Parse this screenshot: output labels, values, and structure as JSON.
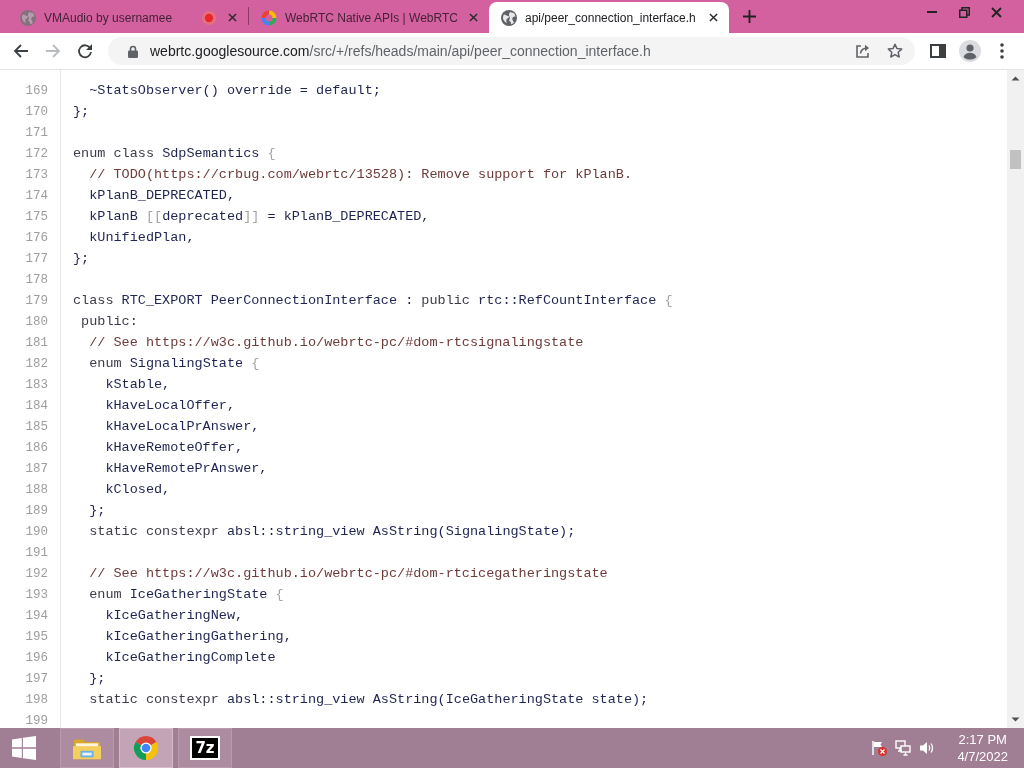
{
  "tabs": [
    {
      "title": "VMAudio by usernamee",
      "recording": true,
      "selected": false
    },
    {
      "title": "WebRTC Native APIs | WebRTC",
      "recording": false,
      "selected": false
    },
    {
      "title": "api/peer_connection_interface.h",
      "recording": false,
      "selected": true
    }
  ],
  "toolbar": {
    "back_disabled": false,
    "forward_disabled": true,
    "url_host": "webrtc.googlesource.com",
    "url_path": "/src/+/refs/heads/main/api/peer_connection_interface.h"
  },
  "code": {
    "lines": [
      {
        "number": "169",
        "segments": [
          {
            "text": "  ~StatsObserver() override = default;",
            "kind": "plain"
          }
        ]
      },
      {
        "number": "170",
        "segments": [
          {
            "text": "};",
            "kind": "plain"
          }
        ]
      },
      {
        "number": "171"
      },
      {
        "number": "172",
        "segments": [
          {
            "text": "enum class ",
            "kind": "keyword"
          },
          {
            "text": "SdpSemantics ",
            "kind": "plain"
          },
          {
            "text": "{",
            "kind": "punct"
          }
        ]
      },
      {
        "number": "173",
        "segments": [
          {
            "text": "  // TODO(https://crbug.com/webrtc/13528): Remove support for kPlanB.",
            "kind": "comment"
          }
        ]
      },
      {
        "number": "174",
        "segments": [
          {
            "text": "  kPlanB_DEPRECATED,",
            "kind": "plain"
          }
        ]
      },
      {
        "number": "175",
        "segments": [
          {
            "text": "  kPlanB ",
            "kind": "plain"
          },
          {
            "text": "[[",
            "kind": "punct"
          },
          {
            "text": "deprecated",
            "kind": "plain"
          },
          {
            "text": "]]",
            "kind": "punct"
          },
          {
            "text": " = kPlanB_DEPRECATED,",
            "kind": "plain"
          }
        ]
      },
      {
        "number": "176",
        "segments": [
          {
            "text": "  kUnifiedPlan,",
            "kind": "plain"
          }
        ]
      },
      {
        "number": "177",
        "segments": [
          {
            "text": "};",
            "kind": "plain"
          }
        ]
      },
      {
        "number": "178"
      },
      {
        "number": "179",
        "segments": [
          {
            "text": "class ",
            "kind": "keyword"
          },
          {
            "text": "RTC_EXPORT PeerConnectionInterface : ",
            "kind": "plain"
          },
          {
            "text": "public ",
            "kind": "keyword"
          },
          {
            "text": "rtc::RefCountInterface ",
            "kind": "plain"
          },
          {
            "text": "{",
            "kind": "punct"
          }
        ]
      },
      {
        "number": "180",
        "segments": [
          {
            "text": " public:",
            "kind": "keyword"
          }
        ]
      },
      {
        "number": "181",
        "segments": [
          {
            "text": "  // See https://w3c.github.io/webrtc-pc/#dom-rtcsignalingstate",
            "kind": "comment"
          }
        ]
      },
      {
        "number": "182",
        "segments": [
          {
            "text": "  enum ",
            "kind": "keyword"
          },
          {
            "text": "SignalingState ",
            "kind": "plain"
          },
          {
            "text": "{",
            "kind": "punct"
          }
        ]
      },
      {
        "number": "183",
        "segments": [
          {
            "text": "    kStable,",
            "kind": "plain"
          }
        ]
      },
      {
        "number": "184",
        "segments": [
          {
            "text": "    kHaveLocalOffer,",
            "kind": "plain"
          }
        ]
      },
      {
        "number": "185",
        "segments": [
          {
            "text": "    kHaveLocalPrAnswer,",
            "kind": "plain"
          }
        ]
      },
      {
        "number": "186",
        "segments": [
          {
            "text": "    kHaveRemoteOffer,",
            "kind": "plain"
          }
        ]
      },
      {
        "number": "187",
        "segments": [
          {
            "text": "    kHaveRemotePrAnswer,",
            "kind": "plain"
          }
        ]
      },
      {
        "number": "188",
        "segments": [
          {
            "text": "    kClosed,",
            "kind": "plain"
          }
        ]
      },
      {
        "number": "189",
        "segments": [
          {
            "text": "  };",
            "kind": "plain"
          }
        ]
      },
      {
        "number": "190",
        "segments": [
          {
            "text": "  static constexpr ",
            "kind": "keyword"
          },
          {
            "text": "absl::string_view AsString(SignalingState);",
            "kind": "plain"
          }
        ]
      },
      {
        "number": "191"
      },
      {
        "number": "192",
        "segments": [
          {
            "text": "  // See https://w3c.github.io/webrtc-pc/#dom-rtcicegatheringstate",
            "kind": "comment"
          }
        ]
      },
      {
        "number": "193",
        "segments": [
          {
            "text": "  enum ",
            "kind": "keyword"
          },
          {
            "text": "IceGatheringState ",
            "kind": "plain"
          },
          {
            "text": "{",
            "kind": "punct"
          }
        ]
      },
      {
        "number": "194",
        "segments": [
          {
            "text": "    kIceGatheringNew,",
            "kind": "plain"
          }
        ]
      },
      {
        "number": "195",
        "segments": [
          {
            "text": "    kIceGatheringGathering,",
            "kind": "plain"
          }
        ]
      },
      {
        "number": "196",
        "segments": [
          {
            "text": "    kIceGatheringComplete",
            "kind": "plain"
          }
        ]
      },
      {
        "number": "197",
        "segments": [
          {
            "text": "  };",
            "kind": "plain"
          }
        ]
      },
      {
        "number": "198",
        "segments": [
          {
            "text": "  static constexpr ",
            "kind": "keyword"
          },
          {
            "text": "absl::string_view AsString(IceGatheringState state);",
            "kind": "plain"
          }
        ]
      },
      {
        "number": "199"
      }
    ]
  },
  "taskbar": {
    "apps": [
      {
        "kind": "explorer",
        "selected": false
      },
      {
        "kind": "browser",
        "selected": true
      },
      {
        "kind": "archiver",
        "label": "7z",
        "selected": false
      }
    ],
    "clock": {
      "time": "2:17 PM",
      "date": "4/7/2022"
    }
  }
}
